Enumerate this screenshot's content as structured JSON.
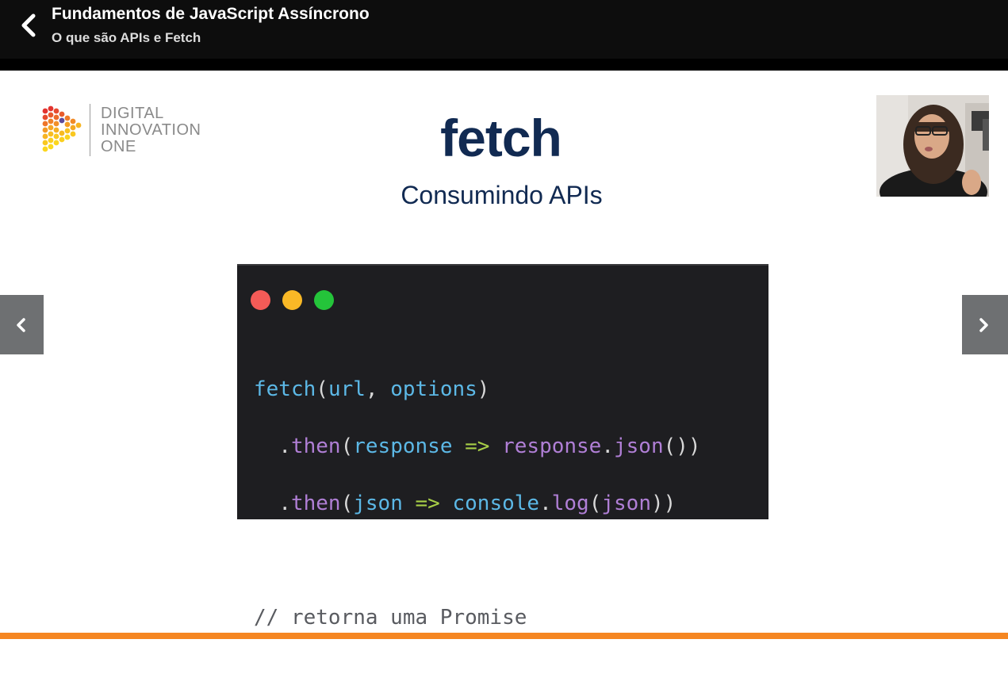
{
  "header": {
    "back_icon": "chevron-left-icon",
    "course_title": "Fundamentos de JavaScript Assíncrono",
    "lesson_title": "O que são APIs e Fetch"
  },
  "slide": {
    "logo": {
      "line1": "DIGITAL",
      "line2": "INNOVATION",
      "line3": "ONE"
    },
    "title": "fetch",
    "subtitle": "Consumindo APIs",
    "code": {
      "line1": {
        "fn": "fetch",
        "open": "(",
        "arg1": "url",
        "comma": ", ",
        "arg2": "options",
        "close": ")"
      },
      "line2": {
        "indent": "  ",
        "dot1": ".",
        "method": "then",
        "open": "(",
        "param": "response",
        "arrow": " => ",
        "obj": "response",
        "dot2": ".",
        "call": "json",
        "close": "())"
      },
      "line3": {
        "indent": "  ",
        "dot1": ".",
        "method": "then",
        "open": "(",
        "param": "json",
        "arrow": " => ",
        "obj": "console",
        "dot2": ".",
        "call": "log",
        "open2": "(",
        "arg": "json",
        "close": "))"
      },
      "comment": "// retorna uma Promise"
    }
  },
  "navigation": {
    "prev_icon": "chevron-left-icon",
    "next_icon": "chevron-right-icon"
  },
  "colors": {
    "accent": "#f58621",
    "title_navy": "#112a52",
    "code_bg": "#1e1e21"
  }
}
